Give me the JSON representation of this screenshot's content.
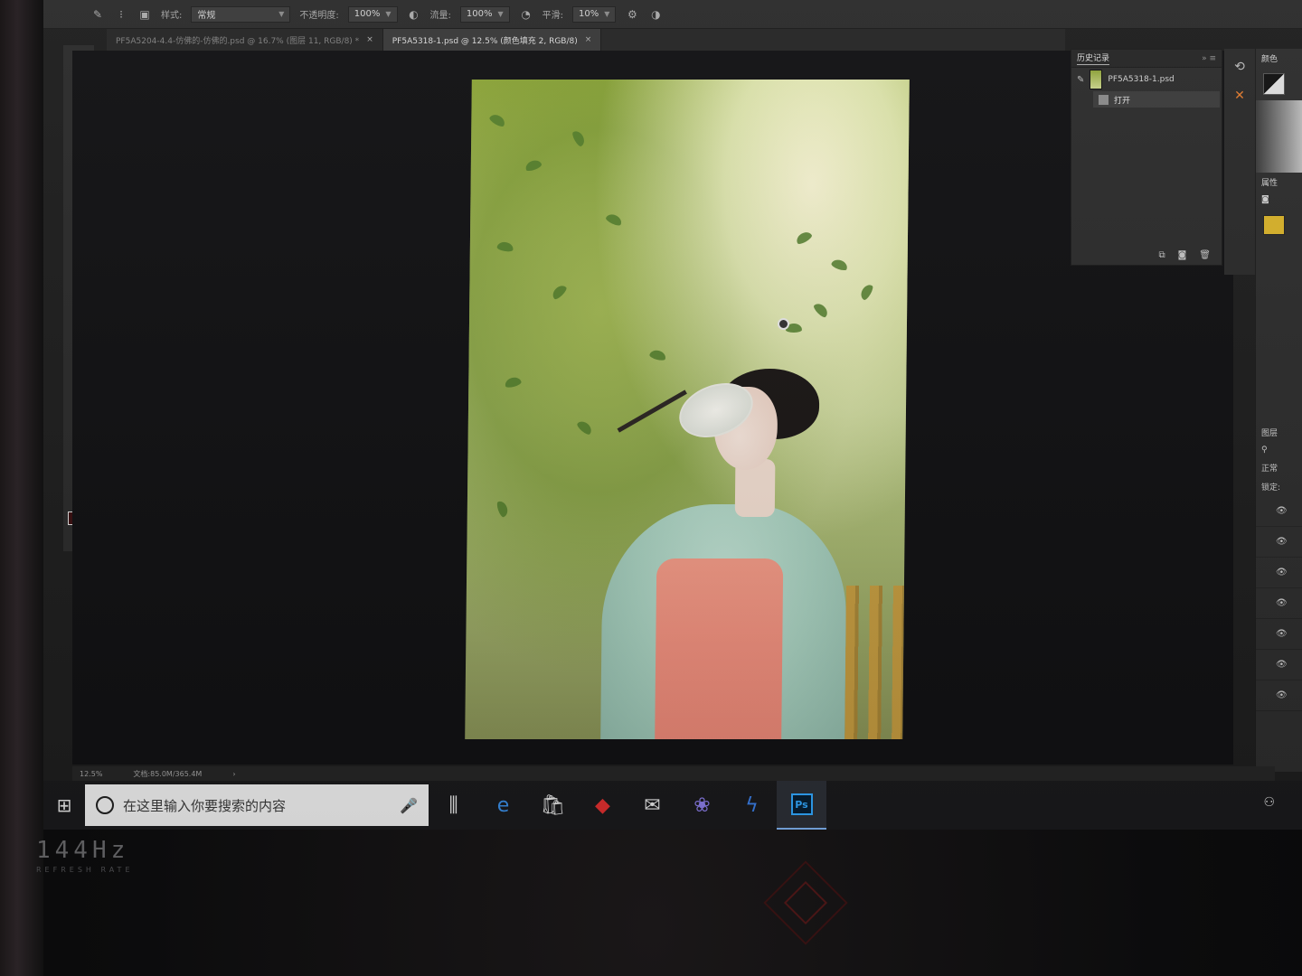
{
  "options_bar": {
    "style_label": "样式:",
    "style_value": "常规",
    "opacity_label": "不透明度:",
    "opacity_value": "100%",
    "flow_label": "流量:",
    "flow_value": "100%",
    "smoothing_label": "平滑:",
    "smoothing_value": "10%"
  },
  "tabs": [
    {
      "label": "PF5A5204-4.4-仿佛的-仿佛的.psd @ 16.7% (图层 11, RGB/8) *",
      "active": false
    },
    {
      "label": "PF5A5318-1.psd @ 12.5% (颜色填充 2, RGB/8)",
      "active": true
    }
  ],
  "history_panel": {
    "title": "历史记录",
    "snapshot_name": "PF5A5318-1.psd",
    "state_label": "打开"
  },
  "right_panels": {
    "color_tab": "颜色",
    "properties_tab": "属性",
    "layers_tab": "图层",
    "blend_mode": "正常",
    "lock_label": "锁定:"
  },
  "status_bar": {
    "zoom": "12.5%",
    "doc_size": "文档:85.0M/365.4M"
  },
  "taskbar": {
    "search_placeholder": "在这里输入你要搜索的内容",
    "ps_label": "Ps"
  },
  "bezel": {
    "refresh_rate": "144Hz",
    "refresh_caption": "REFRESH RATE"
  },
  "colors": {
    "foreground": "#3a0f10",
    "background": "#f4f4f4",
    "accent_ps": "#31a8ff",
    "layer_fill": "#d8b22b"
  }
}
